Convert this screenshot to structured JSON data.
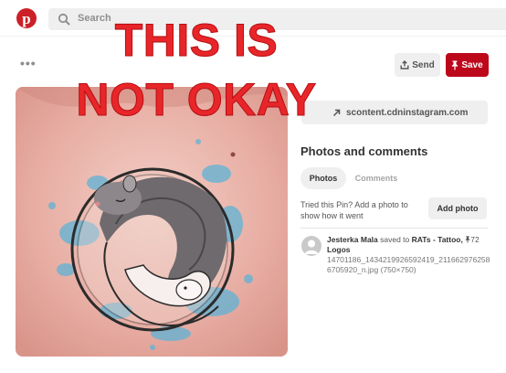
{
  "header": {
    "logo": "pinterest-logo",
    "search_placeholder": "Search"
  },
  "overlay": {
    "line1": "THIS IS",
    "line2": "NOT OKAY"
  },
  "actions": {
    "more_label": "•••",
    "send_label": "Send",
    "save_label": "Save"
  },
  "pin": {
    "image_subject": "rat-tattoo-photo",
    "source_domain": "scontent.cdninstagram.com"
  },
  "comments": {
    "title": "Photos and comments",
    "tabs": [
      {
        "label": "Photos",
        "active": true
      },
      {
        "label": "Comments",
        "active": false
      }
    ],
    "prompt": "Tried this Pin? Add a photo to show how it went",
    "add_photo_label": "Add photo"
  },
  "activity": {
    "user": "Jesterka Mala",
    "action": "saved to",
    "board": "RATs - Tattoo,",
    "pin_count": "72",
    "board_suffix": "Logos",
    "filename": "14701186_1434219926592419_2116629762586705920_n.jpg (750×750)"
  },
  "colors": {
    "pinterest_red": "#bd081c",
    "overlay_red": "#e8262a"
  }
}
